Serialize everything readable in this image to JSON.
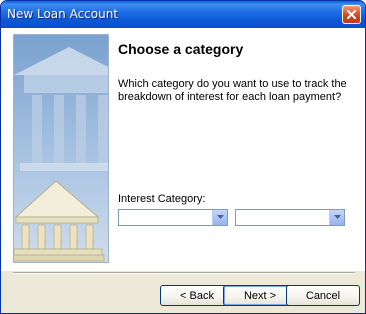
{
  "window": {
    "title": "New Loan Account"
  },
  "page": {
    "heading": "Choose a category",
    "description": "Which category do you want to use to track the breakdown of interest for each loan payment?",
    "category_label": "Interest Category:",
    "category_value": "",
    "subcategory_value": ""
  },
  "buttons": {
    "back": "< Back",
    "next": "Next >",
    "cancel": "Cancel"
  },
  "icons": {
    "close": "close-icon",
    "dropdown": "chevron-down-icon",
    "art": "bank-building-icon"
  },
  "colors": {
    "titlebar": "#0a5fd8",
    "close_button": "#d8461f",
    "dialog_bg": "#ece9d8"
  }
}
